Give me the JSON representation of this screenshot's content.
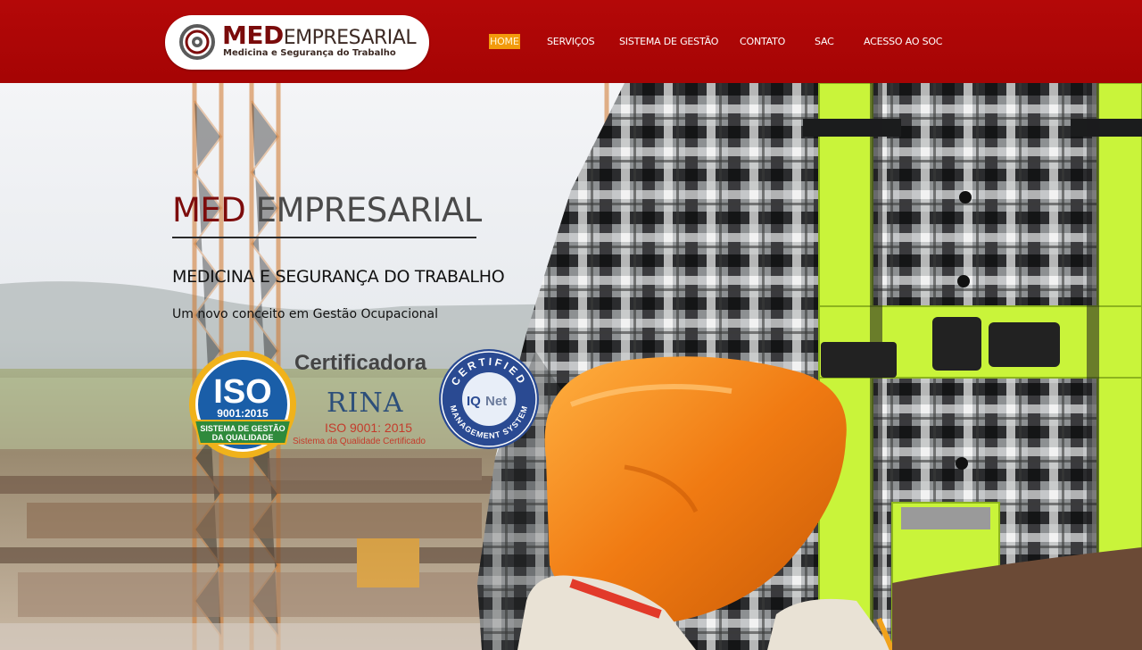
{
  "brand": {
    "name_bold": "MED",
    "name_rest": "EMPRESARIAL",
    "tagline": "Medicina e Segurança do Trabalho"
  },
  "nav": {
    "items": [
      {
        "label": "HOME",
        "active": true
      },
      {
        "label": "SERVIÇOS",
        "active": false
      },
      {
        "label": "SISTEMA DE GESTÃO",
        "active": false
      },
      {
        "label": "CONTATO",
        "active": false
      },
      {
        "label": "SAC",
        "active": false
      },
      {
        "label": "ACESSO AO SOC",
        "active": false
      }
    ]
  },
  "hero": {
    "title_part1": "MED",
    "title_part2": "EMPRESARIAL",
    "subtitle": "MEDICINA E SEGURANÇA DO TRABALHO",
    "description": "Um novo conceito em Gestão Ocupacional"
  },
  "badges": {
    "iso": {
      "big": "ISO",
      "number": "9001:2015",
      "banner_line1": "SISTEMA DE GESTÃO",
      "banner_line2": "DA QUALIDADE"
    },
    "certifier": {
      "title": "Certificadora",
      "org": "RINA",
      "standard": "ISO 9001: 2015",
      "caption": "Sistema da Qualidade Certificado"
    },
    "iqnet": {
      "top_text": "CERTIFIED",
      "bottom_text": "MANAGEMENT SYSTEM",
      "logo_iq": "IQ",
      "logo_net": "Net"
    }
  },
  "colors": {
    "header_red": "#b40808",
    "brand_dark_red": "#7d0c0c",
    "nav_active": "#f29a0c",
    "iso_blue": "#1a5ea8",
    "iso_green": "#2f8a3c",
    "iso_gold": "#f0b21b",
    "helmet_orange": "#f07a12",
    "vest_yellow": "#c9f43a"
  }
}
